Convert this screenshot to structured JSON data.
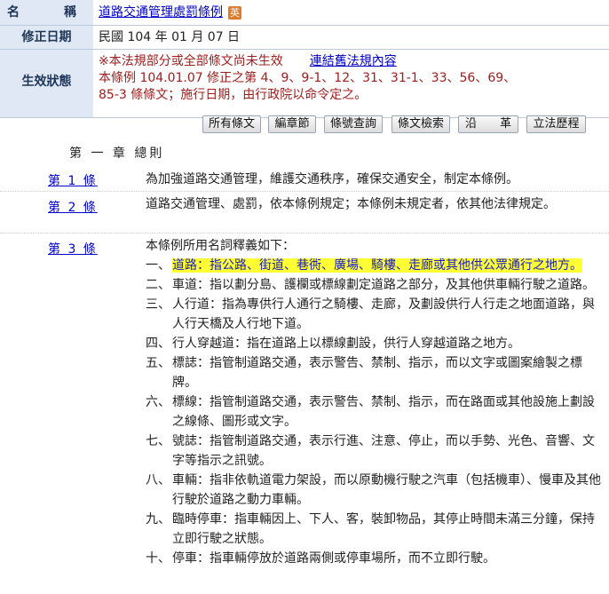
{
  "meta": {
    "name_label": "名　稱",
    "law_title": "道路交通管理處罰條例",
    "english_badge": "英",
    "amend_label": "修正日期",
    "amend_date": "民國 104 年 01 月 07 日",
    "effect_label": "生效狀態",
    "effect_line1": "※本法規部分或全部條文尚未生效",
    "old_law_link": "連結舊法規內容",
    "effect_line2": "本條例 104.01.07  修正之第 4、9、9-1、12、31、31-1、33、56、69、",
    "effect_line3": "85-3  條條文；施行日期，由行政院以命令定之。"
  },
  "buttons": [
    "所有條文",
    "編章節",
    "條號查詢",
    "條文檢索",
    "沿　　革",
    "立法歷程"
  ],
  "chapter": "第 一 章  總則",
  "articles": [
    {
      "no": "第 1 條",
      "text": "為加強道路交通管理，維護交通秩序，確保交通安全，制定本條例。"
    },
    {
      "no": "第 2 條",
      "text": "道路交通管理、處罰，依本條例規定；本條例未規定者，依其他法律規定。"
    },
    {
      "no": "第 3 條",
      "text": "本條例所用名詞釋義如下："
    }
  ],
  "definitions": [
    {
      "num": "一、",
      "text": "道路：指公路、街道、巷衖、廣場、騎樓、走廊或其他供公眾通行之地方。"
    },
    {
      "num": "二、",
      "text": "車道：指以劃分島、護欄或標線劃定道路之部分，及其他供車輛行駛之道路。"
    },
    {
      "num": "三、",
      "text": "人行道：指為專供行人通行之騎樓、走廊，及劃設供行人行走之地面道路，與人行天橋及人行地下道。"
    },
    {
      "num": "四、",
      "text": "行人穿越道：指在道路上以標線劃設，供行人穿越道路之地方。"
    },
    {
      "num": "五、",
      "text": "標誌：指管制道路交通，表示警告、禁制、指示，而以文字或圖案繪製之標牌。"
    },
    {
      "num": "六、",
      "text": "標線：指管制道路交通，表示警告、禁制、指示，而在路面或其他設施上劃設之線條、圖形或文字。"
    },
    {
      "num": "七、",
      "text": "號誌：指管制道路交通，表示行進、注意、停止，而以手勢、光色、音響、文字等指示之訊號。"
    },
    {
      "num": "八、",
      "text": "車輛：指非依軌道電力架設，而以原動機行駛之汽車（包括機車）、慢車及其他行駛於道路之動力車輛。"
    },
    {
      "num": "九、",
      "text": "臨時停車：指車輛因上、下人、客，裝卸物品，其停止時間未滿三分鐘，保持立即行駛之狀態。"
    },
    {
      "num": "十、",
      "text": "停車：指車輛停放於道路兩側或停車場所，而不立即行駛。"
    }
  ]
}
